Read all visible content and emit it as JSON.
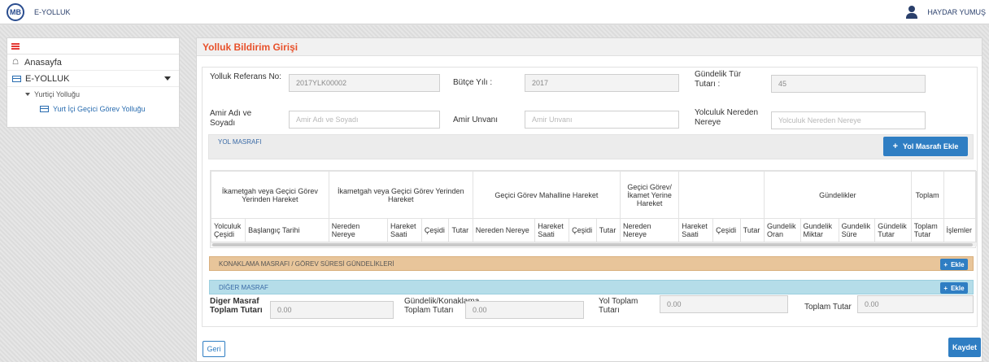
{
  "topbar": {
    "logo_text": "MB",
    "app_name": "E-YOLLUK",
    "user_name": "HAYDAR YUMUŞ"
  },
  "sidebar": {
    "items": [
      {
        "label": "Anasayfa",
        "icon": "home-icon"
      },
      {
        "label": "E-YOLLUK",
        "icon": "card-icon"
      }
    ],
    "sub_label": "Yurtiçi Yolluğu",
    "subsub_label": "Yurt İçi Geçici Görev Yolluğu"
  },
  "page": {
    "title": "Yolluk Bildirim Girişi"
  },
  "form": {
    "ref_label": "Yolluk Referans No:",
    "ref_value": "2017YLK00002",
    "butce_label": "Bütçe Yılı :",
    "butce_value": "2017",
    "gundelik_label": "Gündelik Tür Tutarı :",
    "gundelik_value": "45",
    "amir_label": "Amir Adı ve Soyadı",
    "amir_placeholder": "Amir Adı ve Soyadı",
    "unvan_label": "Amir Unvanı",
    "unvan_placeholder": "Amir Unvanı",
    "nereden_label": "Yolculuk Nereden Nereye",
    "nereden_placeholder": "Yolculuk Nereden Nereye"
  },
  "yol_masrafi": {
    "title": "YOL MASRAFI",
    "add_button": "Yol Masrafı Ekle"
  },
  "table": {
    "group_headers": [
      "İkametgah veya Geçici Görev Yerinden Hareket",
      "İkametgah veya Geçici Görev Yerinden Hareket",
      "Geçici Görev Mahalline Hareket",
      "Geçici Görev/ İkamet Yerine Hareket",
      "Gündelikler",
      "Toplam"
    ],
    "columns": [
      "Yolculuk Çeşidi",
      "Başlangıç Tarihi",
      "Nereden Nereye",
      "Hareket Saati",
      "Çeşidi",
      "Tutar",
      "Nereden Nereye",
      "Hareket Saati",
      "Çeşidi",
      "Tutar",
      "Nereden Nereye",
      "Hareket Saati",
      "Çeşidi",
      "Tutar",
      "Gundelik Oran",
      "Gundelik Miktar",
      "Gundelik Süre",
      "Gündelik Tutar",
      "Toplam Tutar",
      "İşlemler"
    ]
  },
  "konaklama": {
    "title": "KONAKLAMA MASRAFI / GÖREV SÜRESİ GÜNDELİKLERİ",
    "add_button": "Ekle"
  },
  "diger": {
    "title": "DİĞER MASRAF",
    "add_button": "Ekle"
  },
  "totals": {
    "diger_label": "Diger Masraf Toplam Tutarı",
    "diger_value": "0.00",
    "gundelik_label": "Gündelik/Konaklama Toplam Tutarı",
    "gundelik_value": "0.00",
    "yol_label": "Yol Toplam Tutarı",
    "yol_value": "0.00",
    "toplam_label": "Toplam Tutar",
    "toplam_value": "0.00"
  },
  "actions": {
    "back": "Geri",
    "save": "Kaydet"
  },
  "colors": {
    "accent": "#2f7ec3",
    "title": "#e8512b",
    "orange_bar": "#e8c59a",
    "cyan_bar": "#b5dde9"
  }
}
